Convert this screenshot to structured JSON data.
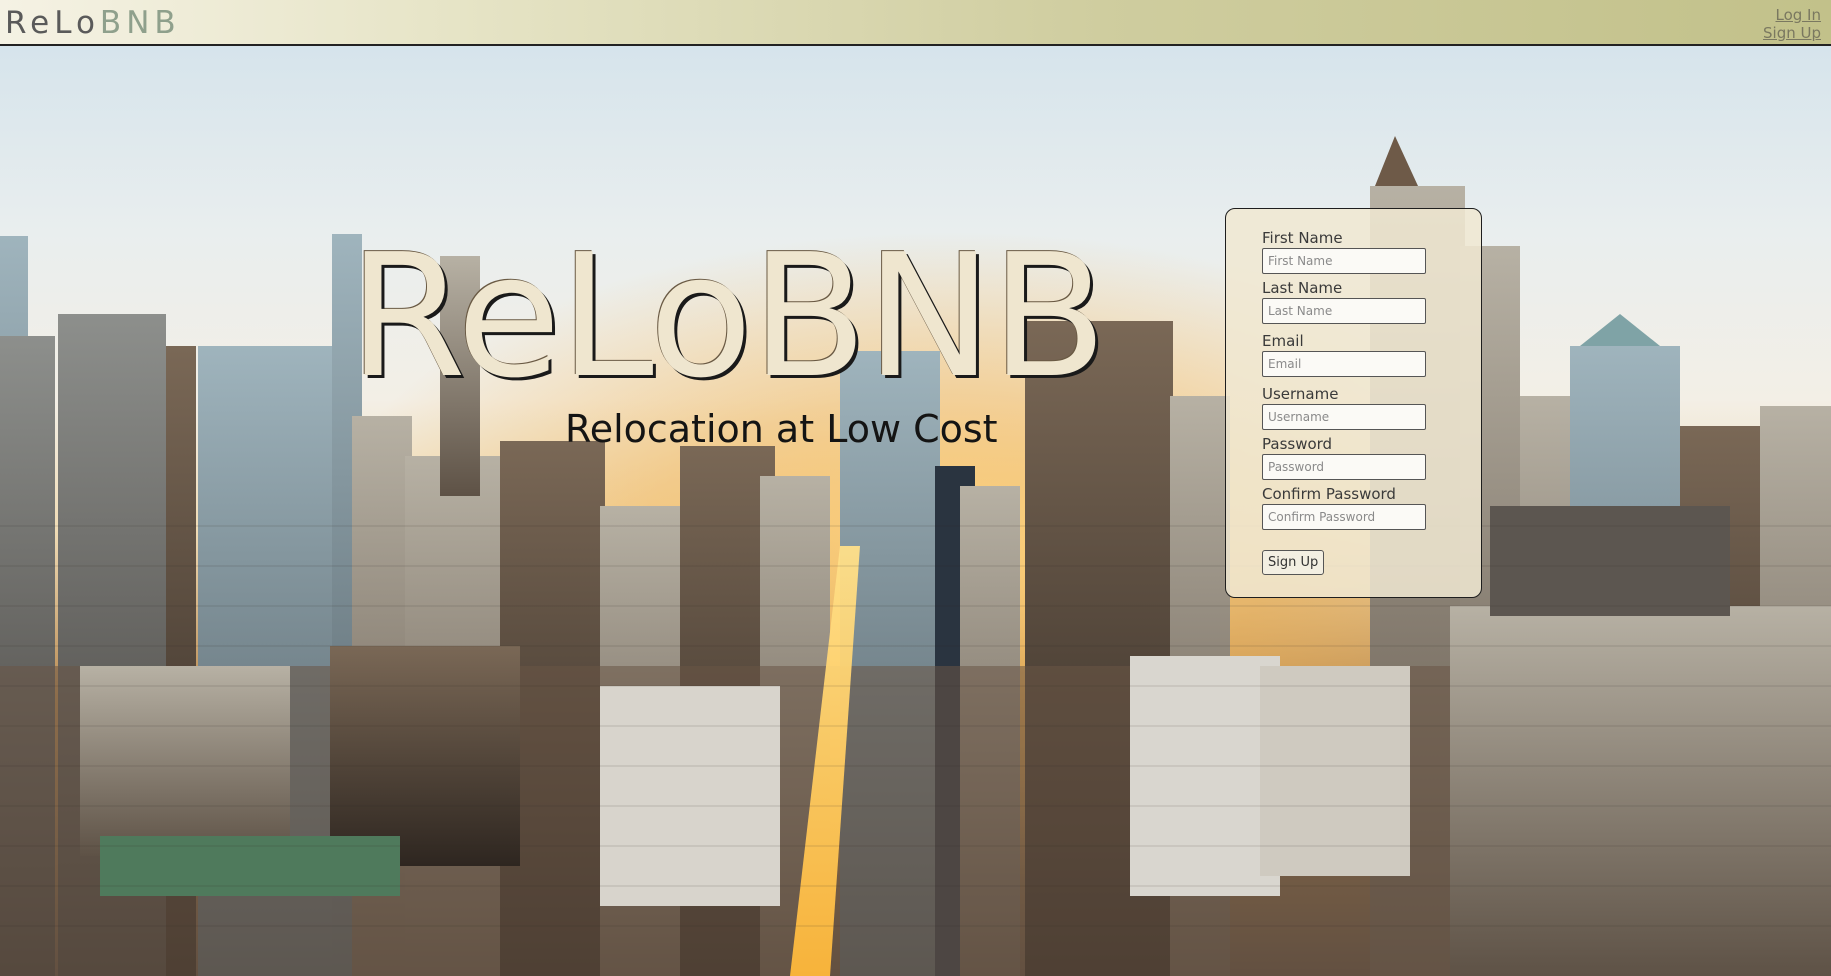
{
  "header": {
    "brand_main": "ReLo",
    "brand_tail": "BNB",
    "login_label": "Log In",
    "signup_label": "Sign Up"
  },
  "hero": {
    "title": "ReLoBNB",
    "subtitle": "Relocation at Low Cost"
  },
  "form": {
    "first_name": {
      "label": "First Name",
      "placeholder": "First Name"
    },
    "last_name": {
      "label": "Last Name",
      "placeholder": "Last Name"
    },
    "email": {
      "label": "Email",
      "placeholder": "Email"
    },
    "username": {
      "label": "Username",
      "placeholder": "Username"
    },
    "password": {
      "label": "Password",
      "placeholder": "Password"
    },
    "confirm_password": {
      "label": "Confirm Password",
      "placeholder": "Confirm Password"
    },
    "submit_label": "Sign Up"
  },
  "colors": {
    "header_gradient_start": "#f5f2e4",
    "header_gradient_end": "#c2c18a",
    "card_background": "#f0e8d2",
    "title_color": "#efe6cf"
  }
}
